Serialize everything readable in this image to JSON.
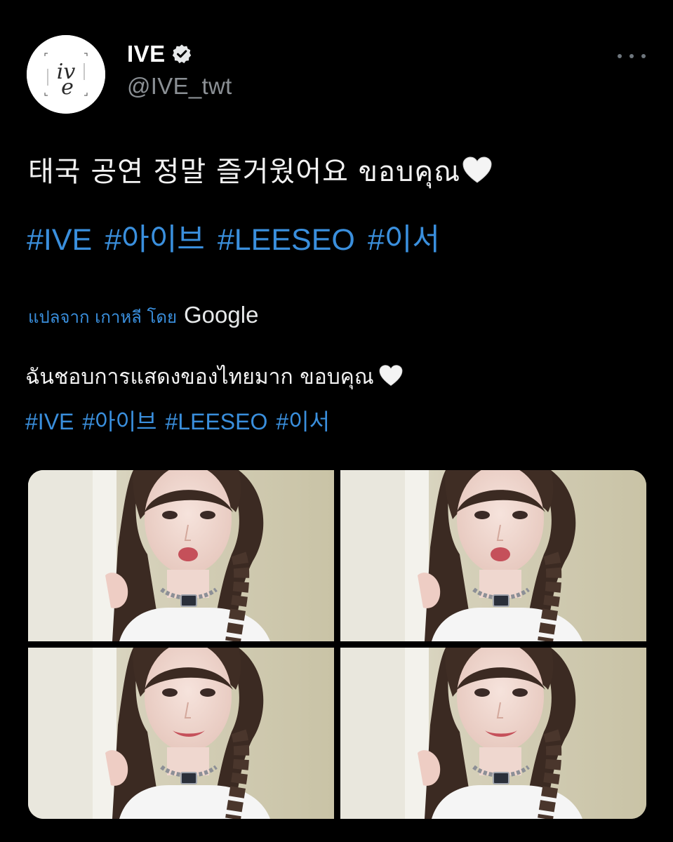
{
  "user": {
    "display_name": "IVE",
    "handle": "@IVE_twt",
    "verified": true,
    "avatar_text": "ive"
  },
  "tweet": {
    "text": "태국 공연 정말 즐거웠어요 ขอบคุณ",
    "hashtags": [
      "#IVE",
      "#아이브",
      "#LEESEO",
      "#이서"
    ]
  },
  "translation": {
    "label": "แปลจาก เกาหลี โดย",
    "provider": "Google",
    "text": "ฉันชอบการแสดงของไทยมาก ขอบคุณ",
    "hashtags": [
      "#IVE",
      "#아이브",
      "#LEESEO",
      "#이서"
    ]
  },
  "media": {
    "photos": [
      {
        "label": "photo-1"
      },
      {
        "label": "photo-2"
      },
      {
        "label": "photo-3"
      },
      {
        "label": "photo-4"
      }
    ]
  },
  "colors": {
    "background": "#000000",
    "link": "#3a8fdd",
    "text": "#f2f2f2",
    "secondary": "#8b9095"
  },
  "icons": {
    "verified": "verified-badge-icon",
    "more": "more-options-icon",
    "heart": "white-heart-emoji"
  }
}
